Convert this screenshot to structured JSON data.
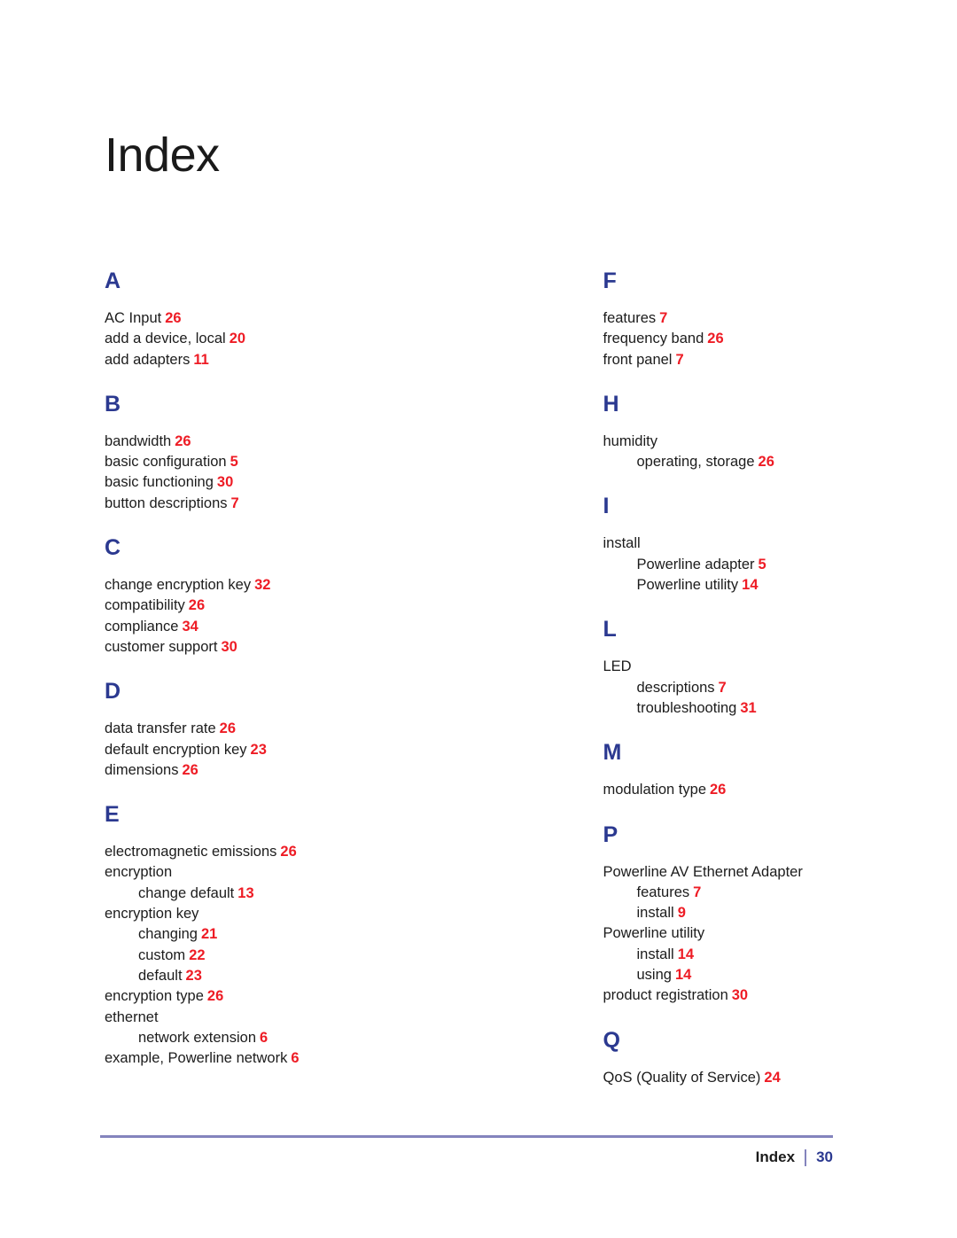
{
  "document": {
    "title": "Index",
    "colors": {
      "section_letter": "#2b3990",
      "page_number": "#ee1c25",
      "rule": "#8484bd",
      "footer_page": "#2b3990",
      "body_text": "#1c1c1c"
    }
  },
  "columns": [
    {
      "name": "left-column",
      "sections": [
        {
          "letter": "A",
          "entries": [
            {
              "level": 1,
              "label": "AC Input",
              "page": "26"
            },
            {
              "level": 1,
              "label": "add a device, local",
              "page": "20"
            },
            {
              "level": 1,
              "label": "add adapters",
              "page": "11"
            }
          ]
        },
        {
          "letter": "B",
          "entries": [
            {
              "level": 1,
              "label": "bandwidth",
              "page": "26"
            },
            {
              "level": 1,
              "label": "basic configuration",
              "page": "5"
            },
            {
              "level": 1,
              "label": "basic functioning",
              "page": "30"
            },
            {
              "level": 1,
              "label": "button descriptions",
              "page": "7"
            }
          ]
        },
        {
          "letter": "C",
          "entries": [
            {
              "level": 1,
              "label": "change encryption key",
              "page": "32"
            },
            {
              "level": 1,
              "label": "compatibility",
              "page": "26"
            },
            {
              "level": 1,
              "label": "compliance",
              "page": "34"
            },
            {
              "level": 1,
              "label": "customer support",
              "page": "30"
            }
          ]
        },
        {
          "letter": "D",
          "entries": [
            {
              "level": 1,
              "label": "data transfer rate",
              "page": "26"
            },
            {
              "level": 1,
              "label": "default encryption key",
              "page": "23"
            },
            {
              "level": 1,
              "label": "dimensions",
              "page": "26"
            }
          ]
        },
        {
          "letter": "E",
          "entries": [
            {
              "level": 1,
              "label": "electromagnetic emissions",
              "page": "26"
            },
            {
              "level": 1,
              "label": "encryption",
              "page": ""
            },
            {
              "level": 2,
              "label": "change default",
              "page": "13"
            },
            {
              "level": 1,
              "label": "encryption key",
              "page": ""
            },
            {
              "level": 2,
              "label": "changing",
              "page": "21"
            },
            {
              "level": 2,
              "label": "custom",
              "page": "22"
            },
            {
              "level": 2,
              "label": "default",
              "page": "23"
            },
            {
              "level": 1,
              "label": "encryption type",
              "page": "26"
            },
            {
              "level": 1,
              "label": "ethernet",
              "page": ""
            },
            {
              "level": 2,
              "label": "network extension",
              "page": "6"
            },
            {
              "level": 1,
              "label": "example, Powerline network",
              "page": "6"
            }
          ]
        }
      ]
    },
    {
      "name": "right-column",
      "sections": [
        {
          "letter": "F",
          "entries": [
            {
              "level": 1,
              "label": "features",
              "page": "7"
            },
            {
              "level": 1,
              "label": "frequency band",
              "page": "26"
            },
            {
              "level": 1,
              "label": "front panel",
              "page": "7"
            }
          ]
        },
        {
          "letter": "H",
          "entries": [
            {
              "level": 1,
              "label": "humidity",
              "page": ""
            },
            {
              "level": 2,
              "label": "operating, storage",
              "page": "26"
            }
          ]
        },
        {
          "letter": "I",
          "entries": [
            {
              "level": 1,
              "label": "install",
              "page": ""
            },
            {
              "level": 2,
              "label": "Powerline adapter",
              "page": "5"
            },
            {
              "level": 2,
              "label": "Powerline utility",
              "page": "14"
            }
          ]
        },
        {
          "letter": "L",
          "entries": [
            {
              "level": 1,
              "label": "LED",
              "page": ""
            },
            {
              "level": 2,
              "label": "descriptions",
              "page": "7"
            },
            {
              "level": 2,
              "label": "troubleshooting",
              "page": "31"
            }
          ]
        },
        {
          "letter": "M",
          "entries": [
            {
              "level": 1,
              "label": "modulation type",
              "page": "26"
            }
          ]
        },
        {
          "letter": "P",
          "entries": [
            {
              "level": 1,
              "label": "Powerline AV Ethernet Adapter",
              "page": ""
            },
            {
              "level": 2,
              "label": "features",
              "page": "7"
            },
            {
              "level": 2,
              "label": "install",
              "page": "9"
            },
            {
              "level": 1,
              "label": "Powerline utility",
              "page": ""
            },
            {
              "level": 2,
              "label": "install",
              "page": "14"
            },
            {
              "level": 2,
              "label": "using",
              "page": "14"
            },
            {
              "level": 1,
              "label": "product registration",
              "page": "30"
            }
          ]
        },
        {
          "letter": "Q",
          "entries": [
            {
              "level": 1,
              "label": "QoS (Quality of Service)",
              "page": "24"
            }
          ]
        }
      ]
    }
  ],
  "footer": {
    "label": "Index",
    "separator": "|",
    "page": "30"
  }
}
